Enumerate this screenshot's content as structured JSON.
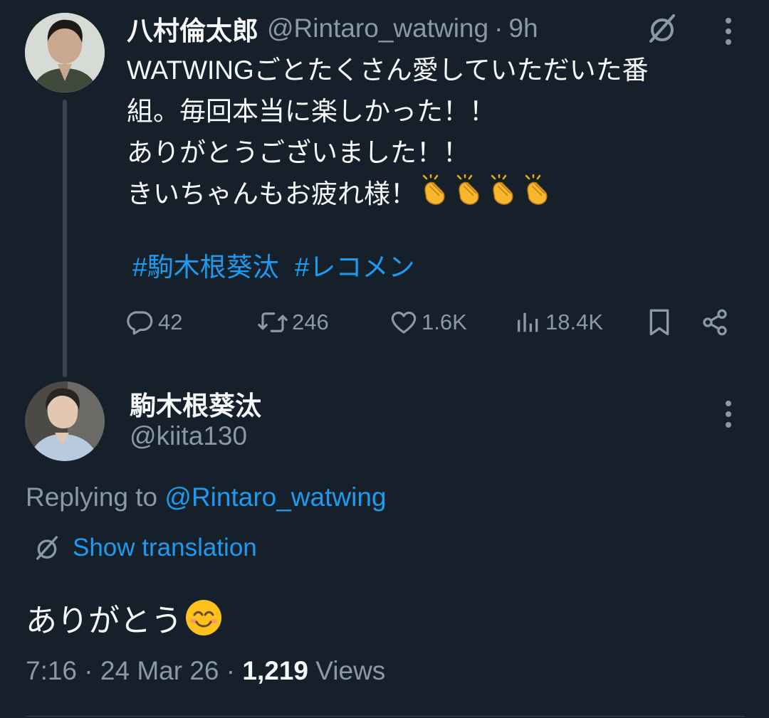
{
  "tweet1": {
    "author_name": "八村倫太郎",
    "handle": "@Rintaro_watwing",
    "separator": "·",
    "time": "9h",
    "text": "WATWINGごとたくさん愛していただいた番\n組。毎回本当に楽しかった！！\nありがとうございました！！\nきいちゃんもお疲れ様！",
    "emojis": [
      "clapping-hands",
      "clapping-hands",
      "clapping-hands",
      "clapping-hands"
    ],
    "hashtags": [
      "#駒木根葵汰",
      "#レコメン"
    ],
    "stats": {
      "replies": "42",
      "reposts": "246",
      "likes": "1.6K",
      "views": "18.4K"
    }
  },
  "tweet2": {
    "author_name": "駒木根葵汰",
    "handle": "@kiita130",
    "replying_prefix": "Replying to ",
    "replying_to": "@Rintaro_watwing",
    "translation_label": "Show translation",
    "text": "ありがとう",
    "emoji": "smiling-face",
    "time": "7:16",
    "date": "24 Mar 26",
    "views_count": "1,219",
    "views_label": "Views",
    "separator": "·"
  },
  "colors": {
    "background": "#15202b",
    "text": "#f7f9f9",
    "muted": "#8b98a5",
    "accent": "#1d9bf0",
    "line": "#38444d"
  }
}
